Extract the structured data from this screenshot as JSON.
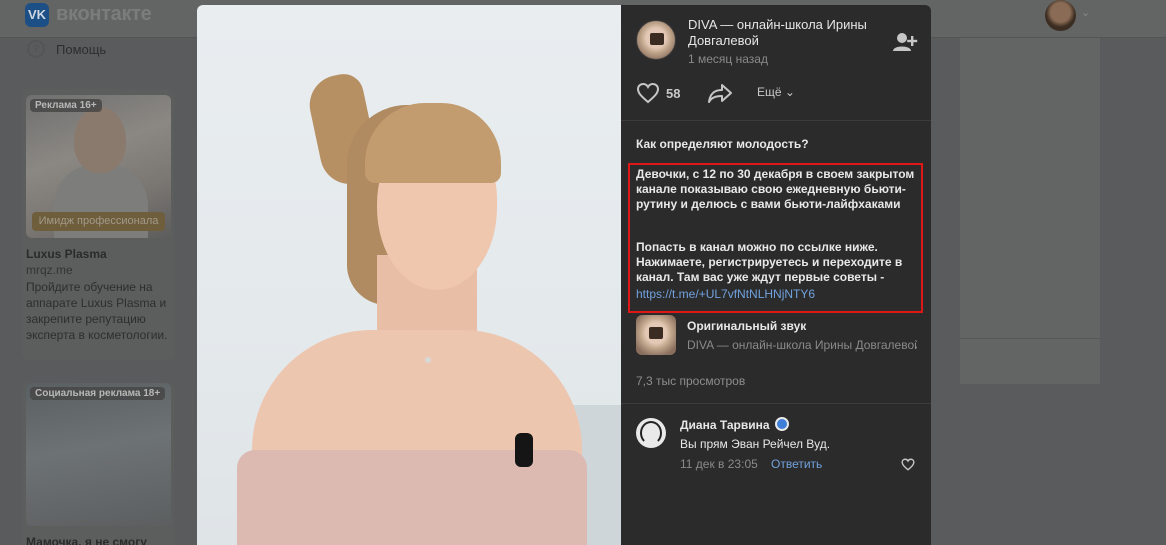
{
  "header": {
    "logo_glyph": "VK",
    "brand": "вконтакте"
  },
  "sidebar": {
    "help_icon_glyph": "?",
    "help_label": "Помощь"
  },
  "ads": [
    {
      "badge": "Реклама 16+",
      "banner": "Имидж профессионала",
      "title": "Luxus Plasma",
      "domain": "mrqz.me",
      "text": "Пройдите обучение на аппарате Luxus Plasma и закрепите репутацию эксперта в косметологии."
    },
    {
      "badge": "Социальная реклама 18+",
      "title": "Мамочка, я не смогу"
    }
  ],
  "post": {
    "author": "DIVA — онлайн-школа Ирины Довгалевой",
    "time": "1 месяц назад",
    "likes": "58",
    "more_label": "Ещё",
    "more_caret": "⌄",
    "title": "Как определяют молодость?",
    "paragraph1": "Девочки, с 12 по 30 декабря в своем закрытом канале показываю свою ежедневную бьюти-рутину и делюсь с вами бьюти-лайфхаками",
    "paragraph2": "Попасть в канал можно по ссылке ниже. Нажимаете, регистрируетесь и переходите в канал. Там вас уже ждут первые советы -",
    "link": "https://t.me/+UL7vfNtNLHNjNTY6",
    "sound_title": "Оригинальный звук",
    "sound_author": "DIVA — онлайн-школа Ирины Довгалевой",
    "views": "7,3 тыс просмотров"
  },
  "comment": {
    "author": "Диана Тарвина",
    "text": "Вы прям Эван Рейчел Вуд.",
    "date": "11 дек в 23:05",
    "reply_label": "Ответить"
  },
  "colors": {
    "panel_bg": "#2b2b2b",
    "link": "#71a2de",
    "highlight": "#e01717"
  }
}
